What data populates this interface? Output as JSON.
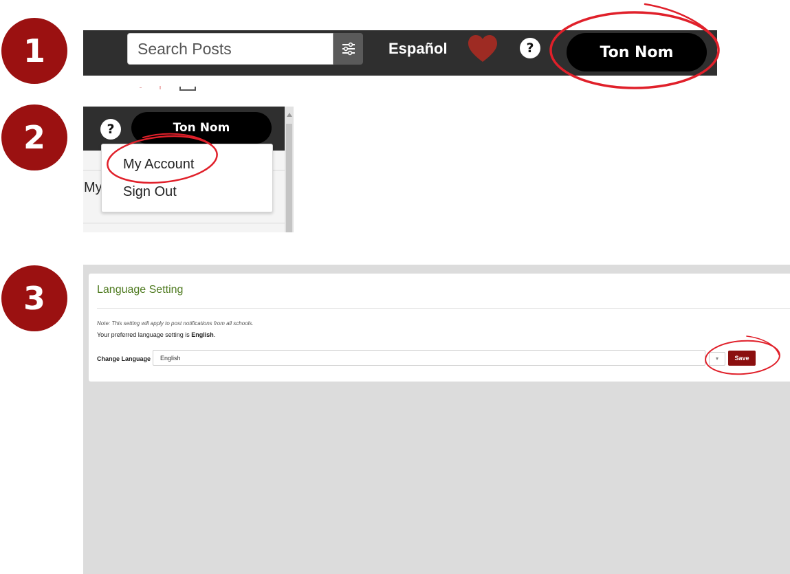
{
  "steps": [
    "1",
    "2",
    "3"
  ],
  "step1": {
    "search_placeholder": "Search Posts",
    "language_link": "Español",
    "user_button": "Ton Nom",
    "help_icon": "?"
  },
  "step2": {
    "user_button": "Ton Nom",
    "help_icon": "?",
    "menu": [
      "My Account",
      "Sign Out"
    ],
    "background_text": "My"
  },
  "step3": {
    "title": "Language Setting",
    "note": "Note: This setting will apply to post notifications from all schools.",
    "preferred_prefix": "Your preferred language setting is ",
    "preferred_value": "English",
    "preferred_suffix": ".",
    "change_label": "Change Language",
    "selected_language": "English",
    "save_button": "Save"
  },
  "colors": {
    "badge": "#9b1111",
    "annotation": "#e0202a",
    "topbar": "#2f2f2f",
    "heart": "#9e2b23",
    "save": "#8b0f0f",
    "title_green": "#4e7a1f"
  },
  "icons": [
    "filter-sliders-icon",
    "heart-icon",
    "help-icon",
    "dropdown-caret-icon"
  ]
}
